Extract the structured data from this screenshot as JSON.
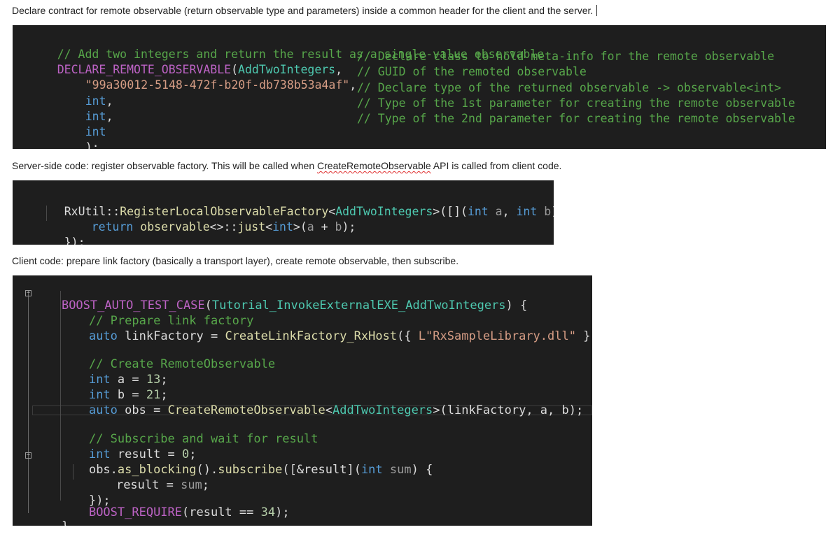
{
  "paragraphs": {
    "p1": "Declare contract for remote observable (return observable type and parameters) inside a common header for the client and the server.",
    "p2_before": "Server-side code: register observable factory. This will be called when ",
    "p2_link": "CreateRemoteObservable",
    "p2_after": " API is called from client code.",
    "p3": "Client code: prepare link factory (basically a transport layer), create remote observable, then subscribe."
  },
  "block1": {
    "l1": "// Add two integers and return the result as a single-value observable",
    "l2_macro": "DECLARE_REMOTE_OBSERVABLE",
    "l2_paren": "(",
    "l2_type": "AddTwoIntegers",
    "l2_comma": ",",
    "l3": "\"99a30012-5148-472f-b20f-db738b53a4af\"",
    "l3_comma": ",",
    "l4_kw": "int",
    "l4_comma": ",",
    "l5_kw": "int",
    "l5_comma": ",",
    "l6_kw": "int",
    "l7": ");",
    "c2": "// Declare class to hold meta-info for the remote observable",
    "c3": "// GUID of the remoted observable",
    "c4": "// Declare type of the returned observable -> observable<int>",
    "c5": "// Type of the 1st parameter for creating the remote observable",
    "c6": "// Type of the 2nd parameter for creating the remote observable"
  },
  "block2": {
    "l1_a": "RxUtil::",
    "l1_fn": "RegisterLocalObservableFactory",
    "l1_lt": "<",
    "l1_type": "AddTwoIntegers",
    "l1_gt": ">([](",
    "l1_int1": "int",
    "l1_a_param": " a",
    "l1_comma": ", ",
    "l1_int2": "int",
    "l1_b_param": " b",
    "l1_end": "){",
    "l2_ret": "return",
    "l2_obs": "observable",
    "l2_mid": "<>::",
    "l2_just": "just",
    "l2_lt": "<",
    "l2_int": "int",
    "l2_gt": ">(",
    "l2_a": "a",
    "l2_plus": " + ",
    "l2_b": "b",
    "l2_end": ");",
    "l3": "});"
  },
  "block3": {
    "l1_macro": "BOOST_AUTO_TEST_CASE",
    "l1_paren": "(",
    "l1_name": "Tutorial_InvokeExternalEXE_AddTwoIntegers",
    "l1_end": ") {",
    "l2": "// Prepare link factory",
    "l3_kw": "auto",
    "l3_var": " linkFactory = ",
    "l3_fn": "CreateLinkFactory_RxHost",
    "l3_open": "({ ",
    "l3_str": "L\"RxSampleLibrary.dll\"",
    "l3_close": " });",
    "l4": "// Create RemoteObservable",
    "l5_kw": "int",
    "l5_rest": " a = ",
    "l5_num": "13",
    "l5_end": ";",
    "l6_kw": "int",
    "l6_rest": " b = ",
    "l6_num": "21",
    "l6_end": ";",
    "l7_kw": "auto",
    "l7_rest": " obs = ",
    "l7_fn": "CreateRemoteObservable",
    "l7_lt": "<",
    "l7_type": "AddTwoIntegers",
    "l7_end": ">(linkFactory, a, b);",
    "l8": "// Subscribe and wait for result",
    "l9_kw": "int",
    "l9_rest": " result = ",
    "l9_num": "0",
    "l9_end": ";",
    "l10_a": "obs.",
    "l10_fn1": "as_blocking",
    "l10_b": "().",
    "l10_fn2": "subscribe",
    "l10_c": "([&result](",
    "l10_kw": "int",
    "l10_param": " sum",
    "l10_end": ") {",
    "l11_a": "result = ",
    "l11_param": "sum",
    "l11_end": ";",
    "l12": "});",
    "l13_macro": "BOOST_REQUIRE",
    "l13_a": "(result == ",
    "l13_num": "34",
    "l13_end": ");",
    "l14": "}",
    "fold_glyph": "−"
  }
}
